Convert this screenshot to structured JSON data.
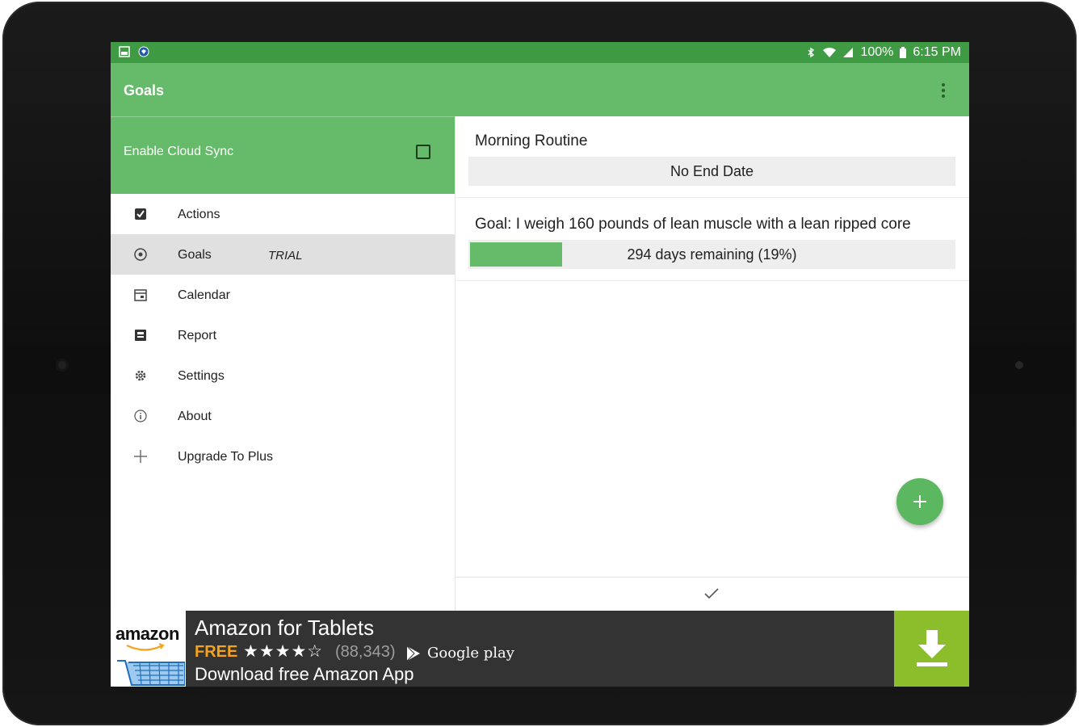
{
  "status_bar": {
    "battery": "100%",
    "time": "6:15 PM"
  },
  "app_bar": {
    "title": "Goals",
    "overflow_icon": "more-vert-icon"
  },
  "sidebar": {
    "cloud_sync_label": "Enable Cloud Sync",
    "cloud_sync_checked": false,
    "items": [
      {
        "label": "Actions",
        "icon": "checkbox-icon",
        "badge": "",
        "active": false
      },
      {
        "label": "Goals",
        "icon": "target-icon",
        "badge": "TRIAL",
        "active": true
      },
      {
        "label": "Calendar",
        "icon": "calendar-icon",
        "badge": "",
        "active": false
      },
      {
        "label": "Report",
        "icon": "report-icon",
        "badge": "",
        "active": false
      },
      {
        "label": "Settings",
        "icon": "gear-icon",
        "badge": "",
        "active": false
      },
      {
        "label": "About",
        "icon": "info-icon",
        "badge": "",
        "active": false
      },
      {
        "label": "Upgrade To Plus",
        "icon": "plus-icon",
        "badge": "",
        "active": false
      }
    ]
  },
  "goals": [
    {
      "title": "Morning Routine",
      "status": "No End Date",
      "progress": 0
    },
    {
      "title": "Goal: I weigh 160 pounds of lean muscle with a lean ripped core",
      "status": "294 days remaining (19%)",
      "progress": 0.19
    }
  ],
  "fab": {
    "icon": "add-icon"
  },
  "bottom": {
    "icon": "check-icon"
  },
  "ad": {
    "logo_text": "amazon",
    "title": "Amazon for Tablets",
    "price": "FREE",
    "stars": "★★★★☆",
    "rating_count": "(88,343)",
    "store": "Google play",
    "subtitle": "Download free Amazon App",
    "download_icon": "download-icon"
  },
  "colors": {
    "status_bar": "#3f9b43",
    "app_bar": "#66bb6a",
    "accent": "#66bb6a",
    "ad_background": "#333333",
    "ad_download": "#8cbd2b",
    "ad_price": "#f6a21b"
  }
}
